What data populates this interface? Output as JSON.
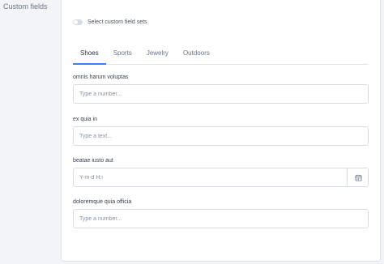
{
  "section": {
    "title": "Custom fields"
  },
  "toggle": {
    "label": "Select custom field sets",
    "checked": false
  },
  "tabs": [
    {
      "label": "Shoes",
      "active": true
    },
    {
      "label": "Sports",
      "active": false
    },
    {
      "label": "Jewelry",
      "active": false
    },
    {
      "label": "Outdoors",
      "active": false
    }
  ],
  "fields": [
    {
      "label": "omnis harum voluptas",
      "placeholder": "Type a number...",
      "value": ""
    },
    {
      "label": "ex quia in",
      "placeholder": "Type a text...",
      "value": ""
    },
    {
      "label": "beatae iusto aut",
      "placeholder": "Y-m-d H:i",
      "value": ""
    },
    {
      "label": "doloremque quia officia",
      "placeholder": "Type a number...",
      "value": ""
    }
  ],
  "icons": {
    "calendar": "calendar-icon"
  },
  "colors": {
    "accent": "#3b82f6",
    "border": "#d8dde5",
    "background": "#f2f4f8"
  }
}
